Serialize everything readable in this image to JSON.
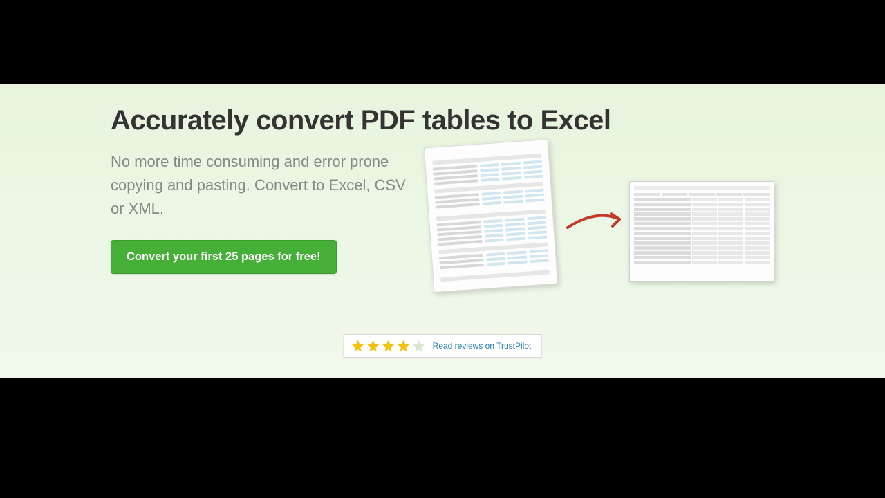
{
  "hero": {
    "headline": "Accurately convert PDF tables to Excel",
    "subhead": "No more time consuming and error prone copying and pasting. Convert to Excel, CSV or XML.",
    "cta_label": "Convert your first 25 pages for free!"
  },
  "reviews": {
    "rating_stars": 4,
    "max_stars": 5,
    "link_text": "Read reviews on TrustPilot"
  },
  "illustration": {
    "source_label": "pdf-document",
    "target_label": "excel-spreadsheet",
    "arrow": "right-arrow"
  },
  "colors": {
    "accent_green": "#45af37",
    "star_gold": "#f4c20d",
    "star_empty": "#d8e7cf",
    "link_blue": "#2a7db3",
    "headline": "#333333",
    "subhead": "#888888"
  }
}
